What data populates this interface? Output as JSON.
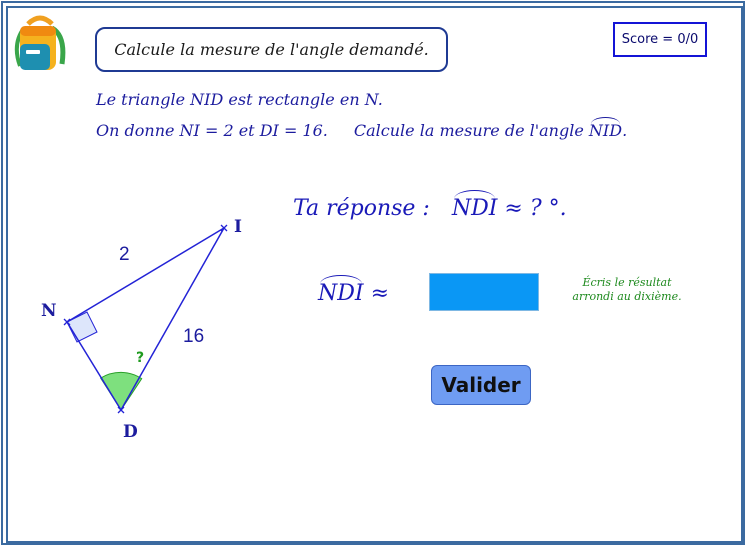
{
  "title": "Calcule la mesure de l'angle demandé.",
  "score": "Score = 0/0",
  "statement": {
    "line1_prefix": "Le triangle ",
    "line1_triangle": "NID",
    "line1_mid": " est rectangle en ",
    "line1_vertex": "N",
    "line1_end": ".",
    "line2_prefix": "On donne  ",
    "given1": "NI = 2",
    "line2_and": " et ",
    "given2": "DI = 16",
    "line2_dot": ".",
    "line2_task": "Calcule la mesure de l'angle ",
    "task_angle": "NID",
    "line2_end": "."
  },
  "prompt": {
    "prefix": "Ta réponse :",
    "angle": "NDI",
    "suffix": "≈ ? °."
  },
  "answer": {
    "angle": "NDI",
    "approx": "≈",
    "value": ""
  },
  "hint": {
    "line1": "Écris le résultat",
    "line2": "arrondi au dixième."
  },
  "submit_label": "Valider",
  "figure": {
    "vertex_n": "N",
    "vertex_i": "I",
    "vertex_d": "D",
    "side_ni": "2",
    "side_di": "16",
    "unknown": "?"
  },
  "colors": {
    "triangle": "#2323d6",
    "right_angle_fill": "#dde6fb",
    "angle_fill": "#7ee07e",
    "question": "#1e9a1e",
    "input_fill": "#0a97f5",
    "button_fill": "#6f9cf2",
    "frame": "#3b6aa0"
  },
  "icons": {
    "logo": "backpack-icon"
  }
}
